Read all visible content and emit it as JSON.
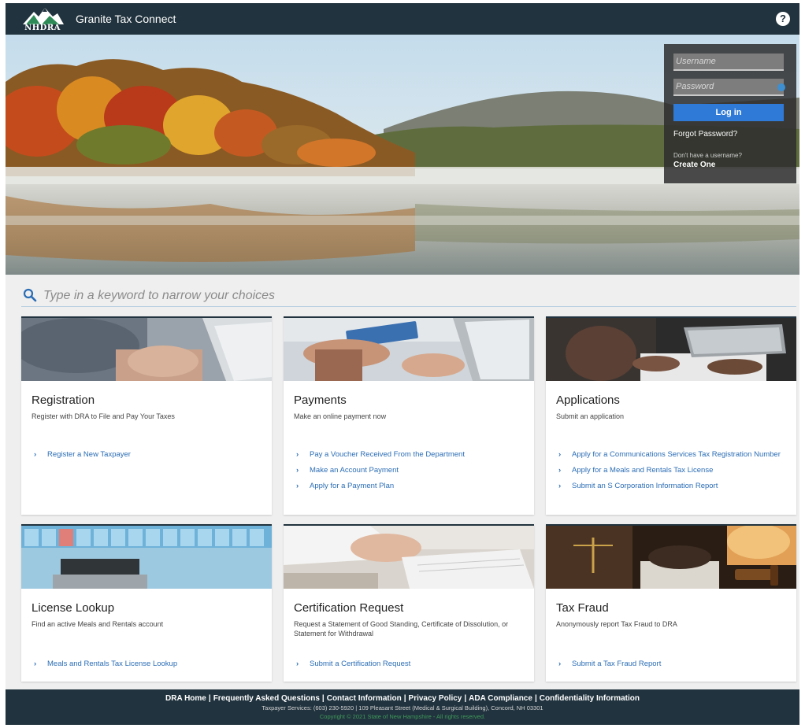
{
  "header": {
    "logo_text": "NHDRA",
    "app_title": "Granite Tax Connect",
    "help_symbol": "?"
  },
  "login": {
    "username_placeholder": "Username",
    "password_placeholder": "Password",
    "login_label": "Log in",
    "forgot_label": "Forgot Password?",
    "no_username_text": "Don't have a username?",
    "create_label": "Create One"
  },
  "search": {
    "placeholder": "Type in a keyword to narrow your choices"
  },
  "cards": [
    {
      "title": "Registration",
      "description": "Register with DRA to File and Pay Your Taxes",
      "links": [
        "Register a New Taxpayer"
      ]
    },
    {
      "title": "Payments",
      "description": "Make an online payment now",
      "links": [
        "Pay a Voucher Received From the Department",
        "Make an Account Payment",
        "Apply for a Payment Plan"
      ]
    },
    {
      "title": "Applications",
      "description": "Submit an application",
      "links": [
        "Apply for a Communications Services Tax Registration Number",
        "Apply for a Meals and Rentals Tax License",
        "Submit an S Corporation Information Report"
      ]
    },
    {
      "title": "License Lookup",
      "description": "Find an active Meals and Rentals account",
      "links": [
        "Meals and Rentals Tax License Lookup"
      ]
    },
    {
      "title": "Certification Request",
      "description": "Request a Statement of Good Standing, Certificate of Dissolution, or Statement for Withdrawal",
      "links": [
        "Submit a Certification Request"
      ]
    },
    {
      "title": "Tax Fraud",
      "description": "Anonymously report Tax Fraud to DRA",
      "links": [
        "Submit a Tax Fraud Report"
      ]
    }
  ],
  "footer": {
    "links": [
      "DRA Home",
      "Frequently Asked Questions",
      "Contact Information",
      "Privacy Policy",
      "ADA Compliance",
      "Confidentiality Information"
    ],
    "address": "Taxpayer Services: (603) 230-5920 | 109 Pleasant Street (Medical & Surgical Building), Concord, NH 03301",
    "copyright": "Copyright © 2021 State of New Hampshire - All rights reserved."
  },
  "colors": {
    "header_bg": "#21333e",
    "accent_blue": "#2e7ad6",
    "link_blue": "#2b6db5"
  }
}
